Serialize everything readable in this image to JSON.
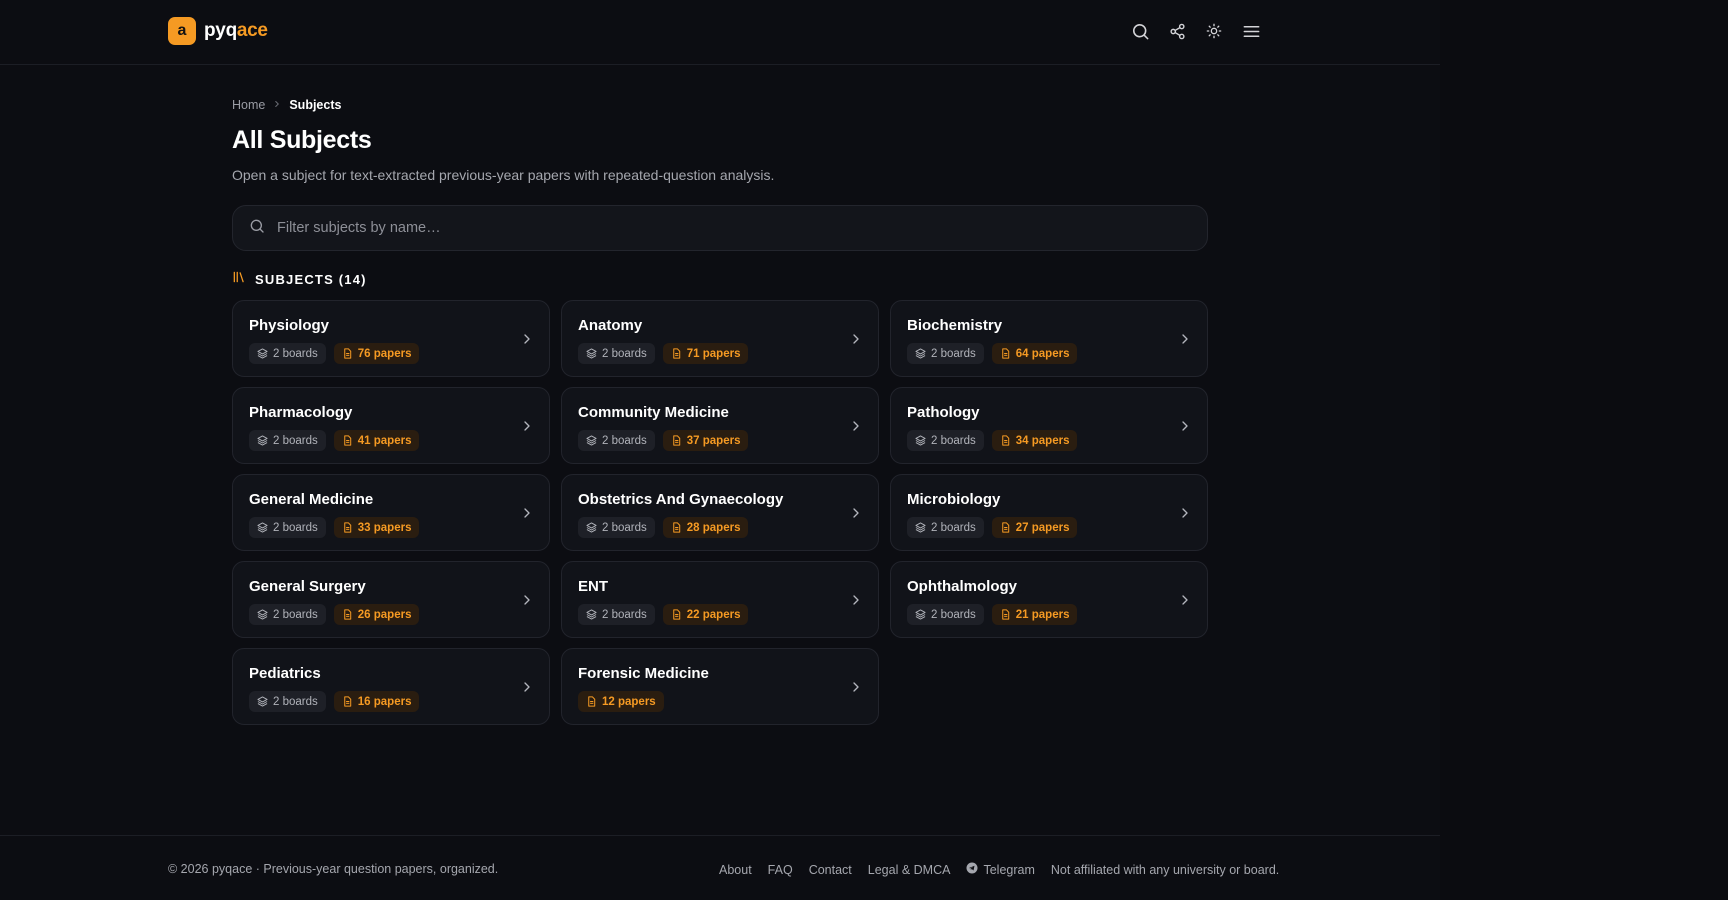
{
  "brand": {
    "mark": "a",
    "name_part1": "pyq",
    "name_part2": "ace",
    "accent": "#f59a23"
  },
  "header_icons": [
    "search-icon",
    "share-icon",
    "sun-icon",
    "menu-icon"
  ],
  "breadcrumb": {
    "home": "Home",
    "current": "Subjects"
  },
  "page": {
    "title": "All Subjects",
    "subtitle": "Open a subject for text-extracted previous-year papers with repeated-question analysis."
  },
  "search": {
    "placeholder": "Filter subjects by name…",
    "value": ""
  },
  "section": {
    "label": "SUBJECTS (14)"
  },
  "subjects": [
    {
      "name": "Physiology",
      "boards": "2 boards",
      "papers": "76 papers"
    },
    {
      "name": "Anatomy",
      "boards": "2 boards",
      "papers": "71 papers"
    },
    {
      "name": "Biochemistry",
      "boards": "2 boards",
      "papers": "64 papers"
    },
    {
      "name": "Pharmacology",
      "boards": "2 boards",
      "papers": "41 papers"
    },
    {
      "name": "Community Medicine",
      "boards": "2 boards",
      "papers": "37 papers"
    },
    {
      "name": "Pathology",
      "boards": "2 boards",
      "papers": "34 papers"
    },
    {
      "name": "General Medicine",
      "boards": "2 boards",
      "papers": "33 papers"
    },
    {
      "name": "Obstetrics And Gynaecology",
      "boards": "2 boards",
      "papers": "28 papers"
    },
    {
      "name": "Microbiology",
      "boards": "2 boards",
      "papers": "27 papers"
    },
    {
      "name": "General Surgery",
      "boards": "2 boards",
      "papers": "26 papers"
    },
    {
      "name": "ENT",
      "boards": "2 boards",
      "papers": "22 papers"
    },
    {
      "name": "Ophthalmology",
      "boards": "2 boards",
      "papers": "21 papers"
    },
    {
      "name": "Pediatrics",
      "boards": "2 boards",
      "papers": "16 papers"
    },
    {
      "name": "Forensic Medicine",
      "boards": "",
      "papers": "12 papers"
    }
  ],
  "footer": {
    "copyright": "© 2026 pyqace · Previous-year question papers, organized.",
    "links": [
      "About",
      "FAQ",
      "Contact",
      "Legal & DMCA"
    ],
    "telegram": "Telegram",
    "disclaimer": "Not affiliated with any university or board."
  }
}
